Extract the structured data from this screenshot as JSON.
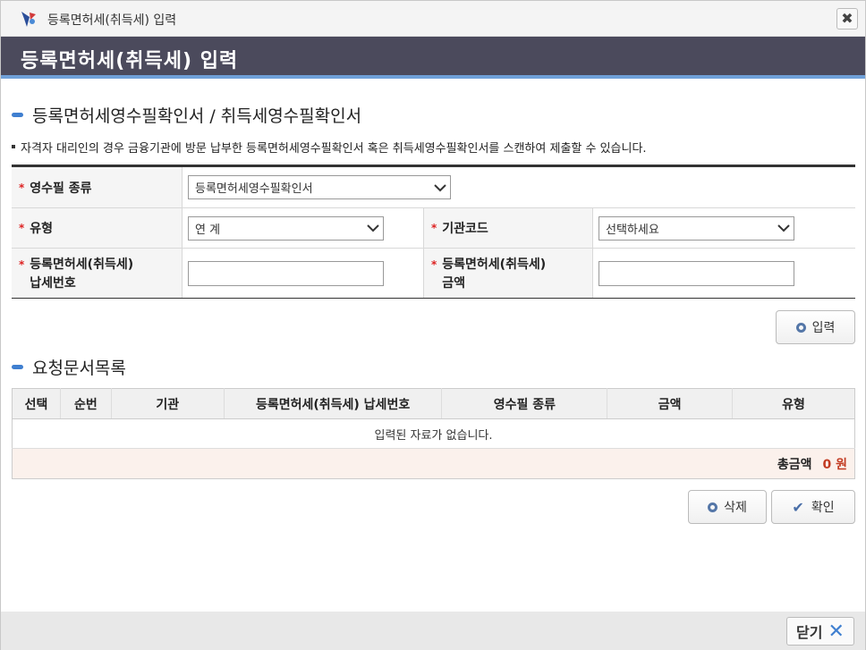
{
  "window": {
    "title": "등록면허세(취득세) 입력",
    "close_symbol": "✖"
  },
  "header": {
    "title": "등록면허세(취득세) 입력"
  },
  "section1": {
    "title": "등록면허세영수필확인서 / 취득세영수필확인서",
    "notice": "자격자 대리인의 경우 금융기관에 방문 납부한 등록면허세영수필확인서 혹은 취득세영수필확인서를 스캔하여 제출할 수 있습니다."
  },
  "form": {
    "receipt_type": {
      "label": "영수필 종류",
      "value": "등록면허세영수필확인서"
    },
    "type": {
      "label": "유형",
      "value": "연  계"
    },
    "org_code": {
      "label": "기관코드",
      "value": "선택하세요"
    },
    "tax_number": {
      "label_line1": "등록면허세(취득세)",
      "label_line2": "납세번호",
      "value": ""
    },
    "tax_amount": {
      "label_line1": "등록면허세(취득세)",
      "label_line2": "금액",
      "value": ""
    },
    "required_mark": "*"
  },
  "buttons": {
    "input": "입력",
    "delete": "삭제",
    "confirm": "확인"
  },
  "section2": {
    "title": "요청문서목록"
  },
  "list": {
    "columns": [
      "선택",
      "순번",
      "기관",
      "등록면허세(취득세) 납세번호",
      "영수필 종류",
      "금액",
      "유형"
    ],
    "empty_message": "입력된 자료가 없습니다.",
    "total_label": "총금액",
    "total_value": "0 원"
  },
  "footer": {
    "close_label": "닫기",
    "close_symbol": "✕"
  }
}
